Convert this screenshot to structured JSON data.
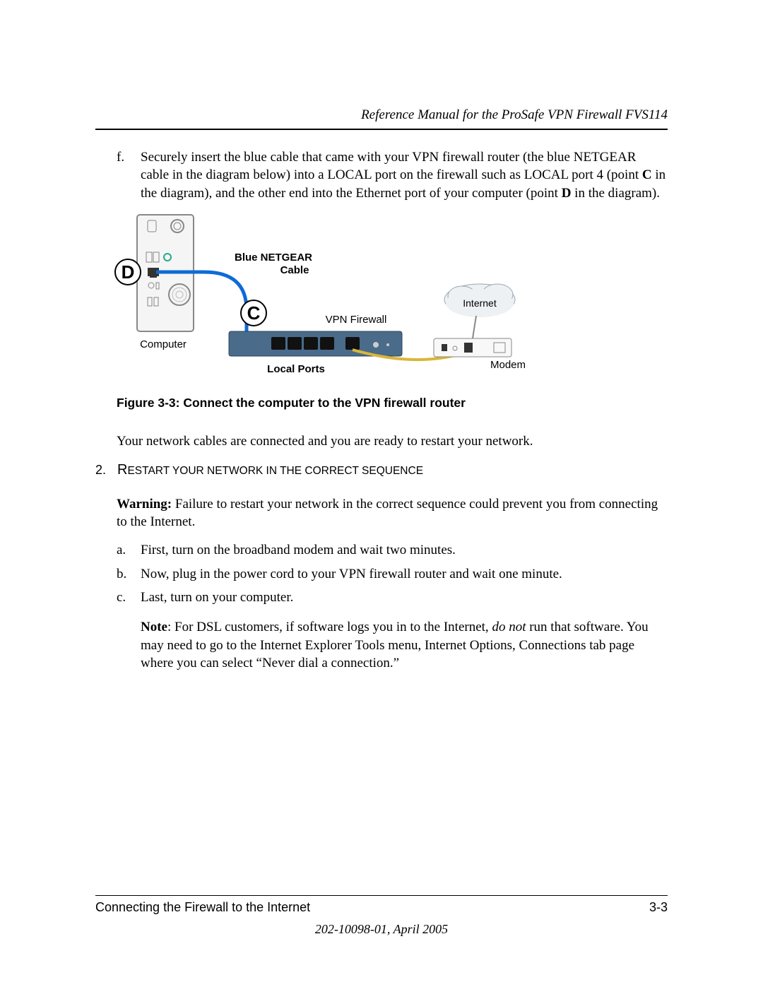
{
  "header": {
    "title": "Reference Manual for the ProSafe VPN Firewall FVS114"
  },
  "step_f": {
    "marker": "f.",
    "text_pre": "Securely insert the blue cable that came with your VPN firewall router (the blue NETGEAR cable in the diagram below) into a LOCAL port on the firewall such as LOCAL port 4 (point ",
    "c_label": "C",
    "text_mid": " in the diagram), and the other end into the Ethernet port of your computer (point ",
    "d_label": "D",
    "text_post": " in the diagram)."
  },
  "figure": {
    "marker_d": "D",
    "marker_c": "C",
    "cable_label1": "Blue NETGEAR",
    "cable_label2": "Cable",
    "vpn_label": "VPN Firewall",
    "internet_label": "Internet",
    "computer_label": "Computer",
    "modem_label": "Modem",
    "local_ports": "Local Ports",
    "caption": "Figure 3-3:  Connect the computer to the VPN firewall router"
  },
  "transition": "Your network cables are connected and you are ready to restart your network.",
  "step2": {
    "number": "2.",
    "heading_first": "R",
    "heading_rest": "ESTART YOUR NETWORK IN THE CORRECT SEQUENCE",
    "warning_label": "Warning:",
    "warning_text": " Failure to restart your network in the correct sequence could prevent you from connecting to the Internet.",
    "items": [
      {
        "marker": "a.",
        "text": "First, turn on the broadband modem and wait two minutes."
      },
      {
        "marker": "b.",
        "text": "Now, plug in the power cord to your VPN firewall router and wait one minute."
      },
      {
        "marker": "c.",
        "text": "Last, turn on your computer."
      }
    ],
    "note_label": "Note",
    "note_pre": ": For DSL customers, if software logs you in to the Internet, ",
    "note_em": "do not",
    "note_post": " run that software. You may need to go to the Internet Explorer Tools menu, Internet Options, Connections tab page where you can select “Never dial a connection.”"
  },
  "footer": {
    "section": "Connecting the Firewall to the Internet",
    "page": "3-3",
    "docid": "202-10098-01, April 2005"
  }
}
